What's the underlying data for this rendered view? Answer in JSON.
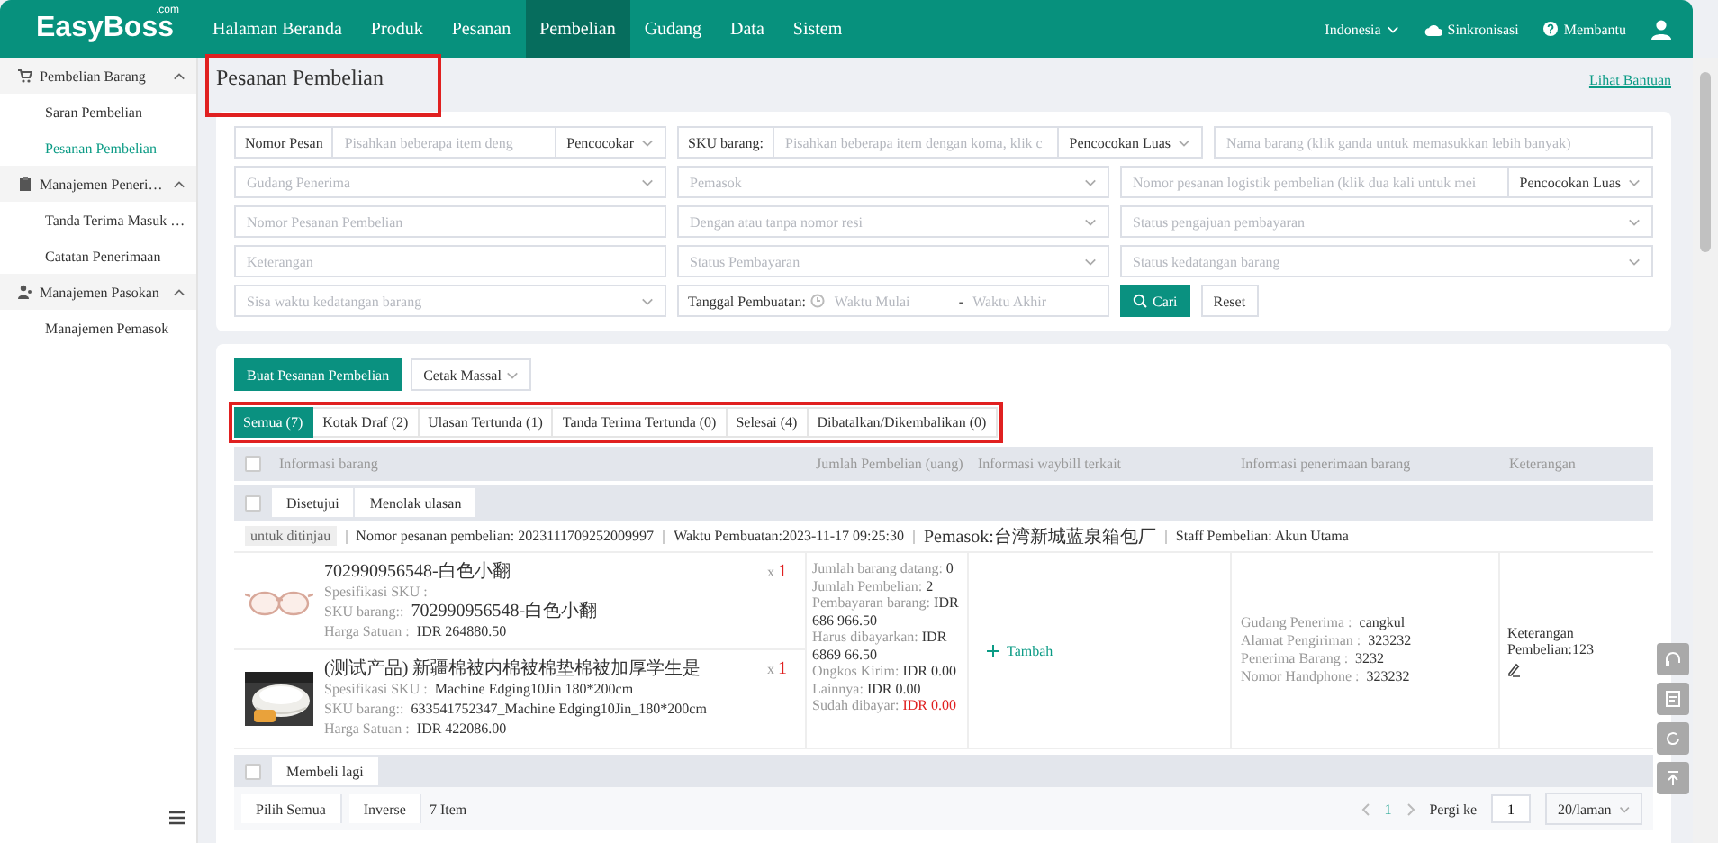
{
  "nav": {
    "logo": "EasyBoss",
    "logo_suffix": ".com",
    "items": [
      {
        "label": "Halaman Beranda",
        "selected": false
      },
      {
        "label": "Produk",
        "selected": false
      },
      {
        "label": "Pesanan",
        "selected": false
      },
      {
        "label": "Pembelian",
        "selected": true
      },
      {
        "label": "Gudang",
        "selected": false
      },
      {
        "label": "Data",
        "selected": false
      },
      {
        "label": "Sistem",
        "selected": false
      }
    ],
    "language": "Indonesia",
    "sync": "Sinkronisasi",
    "help": "Membantu"
  },
  "sidebar": {
    "groups": [
      {
        "label": "Pembelian Barang",
        "expanded": true,
        "items": [
          {
            "label": "Saran Pembelian",
            "selected": false
          },
          {
            "label": "Pesanan Pembelian",
            "selected": true
          }
        ]
      },
      {
        "label": "Manajemen Peneri…",
        "expanded": true,
        "items": [
          {
            "label": "Tanda Terima Masuk …",
            "selected": false
          },
          {
            "label": "Catatan Penerimaan",
            "selected": false
          }
        ]
      },
      {
        "label": "Manajemen Pasokan",
        "expanded": true,
        "items": [
          {
            "label": "Manajemen Pemasok",
            "selected": false
          }
        ]
      }
    ]
  },
  "page": {
    "title": "Pesanan Pembelian",
    "title_highlighted": true,
    "help_link": "Lihat Bantuan"
  },
  "filters": {
    "row1": [
      {
        "kind": "text",
        "label": "Nomor Pesan",
        "placeholder": "Pisahkan beberapa item deng",
        "match": "Pencocokar"
      },
      {
        "kind": "text",
        "label": "SKU barang:",
        "placeholder": "Pisahkan beberapa item dengan koma, klik c",
        "match": "Pencocokan Luas"
      },
      {
        "kind": "text",
        "placeholder": "Nama barang (klik ganda untuk memasukkan lebih banyak)"
      }
    ],
    "grid": [
      {
        "kind": "select",
        "placeholder": "Gudang Penerima"
      },
      {
        "kind": "select",
        "placeholder": "Pemasok"
      },
      {
        "kind": "text",
        "placeholder": "Nomor pesanan logistik pembelian (klik dua kali untuk mei",
        "match": "Pencocokan Luas"
      },
      {
        "kind": "text",
        "placeholder": "Nomor Pesanan Pembelian"
      },
      {
        "kind": "select",
        "placeholder": "Dengan atau tanpa nomor resi"
      },
      {
        "kind": "select",
        "placeholder": "Status pengajuan pembayaran"
      },
      {
        "kind": "text",
        "placeholder": "Keterangan"
      },
      {
        "kind": "select",
        "placeholder": "Status Pembayaran"
      },
      {
        "kind": "select",
        "placeholder": "Status kedatangan barang"
      },
      {
        "kind": "select",
        "placeholder": "Sisa waktu kedatangan barang"
      },
      {
        "kind": "date_range",
        "label": "Tanggal Pembuatan:",
        "start_placeholder": "Waktu Mulai",
        "separator": "-",
        "end_placeholder": "Waktu Akhir"
      },
      {
        "kind": "actions",
        "search": "Cari",
        "reset": "Reset"
      }
    ]
  },
  "toolbar": {
    "create": "Buat Pesanan Pembelian",
    "print": "Cetak Massal"
  },
  "tabs_highlighted": true,
  "tabs": [
    {
      "label": "Semua (7)",
      "selected": true
    },
    {
      "label": "Kotak Draf (2)",
      "selected": false
    },
    {
      "label": "Ulasan Tertunda (1)",
      "selected": false
    },
    {
      "label": "Tanda Terima Tertunda (0)",
      "selected": false
    },
    {
      "label": "Selesai (4)",
      "selected": false
    },
    {
      "label": "Dibatalkan/Dikembalikan (0)",
      "selected": false
    }
  ],
  "table": {
    "header_checked": false,
    "bulk_checked": false,
    "footer_checked": false,
    "columns": [
      "Informasi barang",
      "Jumlah Pembelian (uang)",
      "Informasi waybill terkait",
      "Informasi penerimaan barang",
      "Keterangan"
    ],
    "bulk_actions": [
      "Disetujui",
      "Menolak ulasan"
    ],
    "orders": [
      {
        "status": "untuk ditinjau",
        "meta": [
          "Nomor pesanan pembelian: 2023111709252009997",
          "Waktu Pembuatan:2023-11-17 09:25:30",
          "Pemasok:台湾新城蓝泉箱包厂",
          "Staff Pembelian: Akun Utama"
        ],
        "products": [
          {
            "name": "702990956548-白色小翻",
            "lines": [
              {
                "label": "Spesifikasi SKU :"
              },
              {
                "label": "SKU barang::",
                "value": "702990956548-白色小翻"
              },
              {
                "label": "Harga Satuan :",
                "value": "IDR 264880.50"
              }
            ],
            "qty_prefix": "x",
            "qty": "1"
          },
          {
            "name": "(测试产品) 新疆棉被内棉被棉垫棉被加厚学生是",
            "lines": [
              {
                "label": "Spesifikasi SKU :",
                "value": "Machine Edging10Jin 180*200cm"
              },
              {
                "label": "SKU barang::",
                "value": "633541752347_Machine Edging10Jin_180*200cm"
              },
              {
                "label": "Harga Satuan :",
                "value": "IDR 422086.00"
              }
            ],
            "qty_prefix": "x",
            "qty": "1"
          }
        ],
        "amounts": [
          {
            "label": "Jumlah barang datang:",
            "value": "0",
            "alert": false
          },
          {
            "label": "Jumlah Pembelian:",
            "value": "2",
            "alert": false
          },
          {
            "label": "Pembayaran barang:",
            "value": "IDR 686 966.50",
            "alert": false
          },
          {
            "label": "Harus dibayarkan:",
            "value": "IDR 6869 66.50",
            "alert": false
          },
          {
            "label": "Ongkos Kirim:",
            "value": "IDR 0.00",
            "alert": false
          },
          {
            "label": "Lainnya:",
            "value": "IDR 0.00",
            "alert": false
          },
          {
            "label": "Sudah dibayar:",
            "value": "IDR 0.00",
            "alert": true
          }
        ],
        "waybill_action": "Tambah",
        "receiving": [
          {
            "label": "Gudang Penerima :",
            "value": "cangkul"
          },
          {
            "label": "Alamat Pengiriman :",
            "value": "323232"
          },
          {
            "label": "Penerima Barang :",
            "value": "3232"
          },
          {
            "label": "Nomor Handphone :",
            "value": "323232"
          }
        ],
        "note": "Keterangan Pembelian:123"
      }
    ],
    "footer_action": "Membeli lagi"
  },
  "bottom": {
    "select_all": "Pilih Semua",
    "inverse": "Inverse",
    "count": "7 Item",
    "pages": [
      {
        "label": "1",
        "selected": true
      }
    ],
    "goto_label": "Pergi ke",
    "goto_value": "1",
    "page_size": "20/laman"
  }
}
